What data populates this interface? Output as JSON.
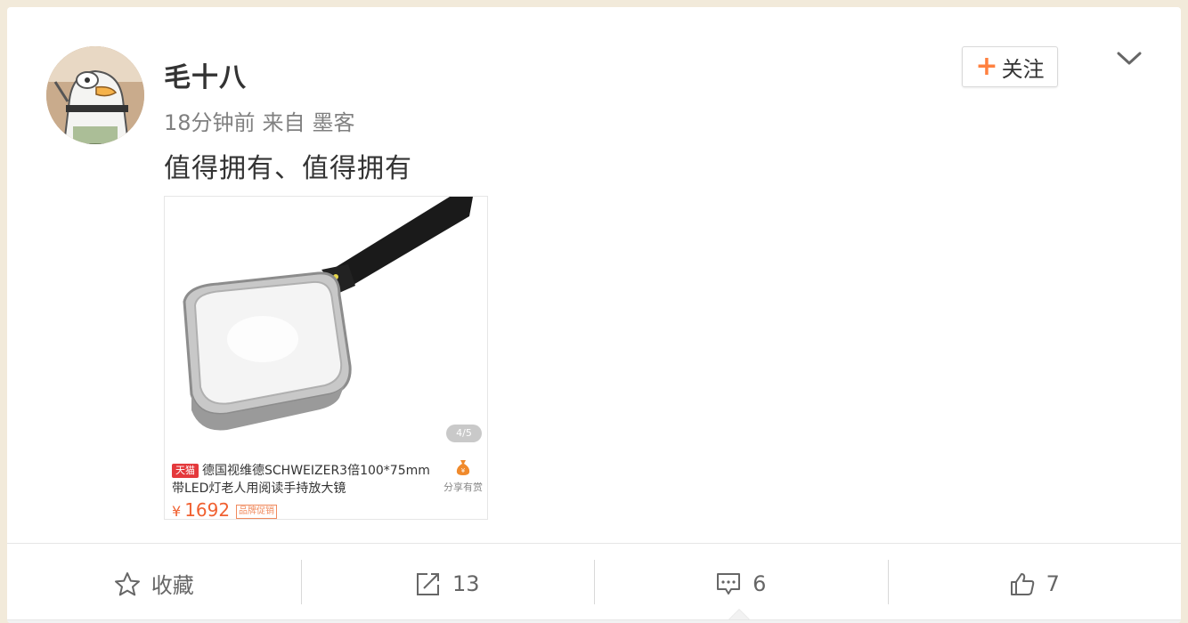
{
  "post": {
    "username": "毛十八",
    "time": "18分钟前",
    "source_prefix": "来自",
    "source": "墨客",
    "text": "值得拥有、值得拥有",
    "follow_label": "关注",
    "avatar_icon": "duck-avatar-icon",
    "menu_icon": "chevron-down-icon"
  },
  "product": {
    "page_indicator": "4/5",
    "badge": "天猫",
    "title_line1": "德国视维德SCHWEIZER3倍100*75mm",
    "title_line2": "带LED灯老人用阅读手持放大镜",
    "currency": "¥",
    "price": "1692",
    "brand_badge": "品牌促销",
    "share_label": "分享有赏",
    "image_icon": "magnifying-glass-product-image"
  },
  "actions": {
    "favorite_label": "收藏",
    "repost_count": "13",
    "comment_count": "6",
    "like_count": "7"
  },
  "colors": {
    "accent_orange": "#ff8140",
    "price_orange": "#f06030",
    "tmall_red": "#e4393c"
  }
}
